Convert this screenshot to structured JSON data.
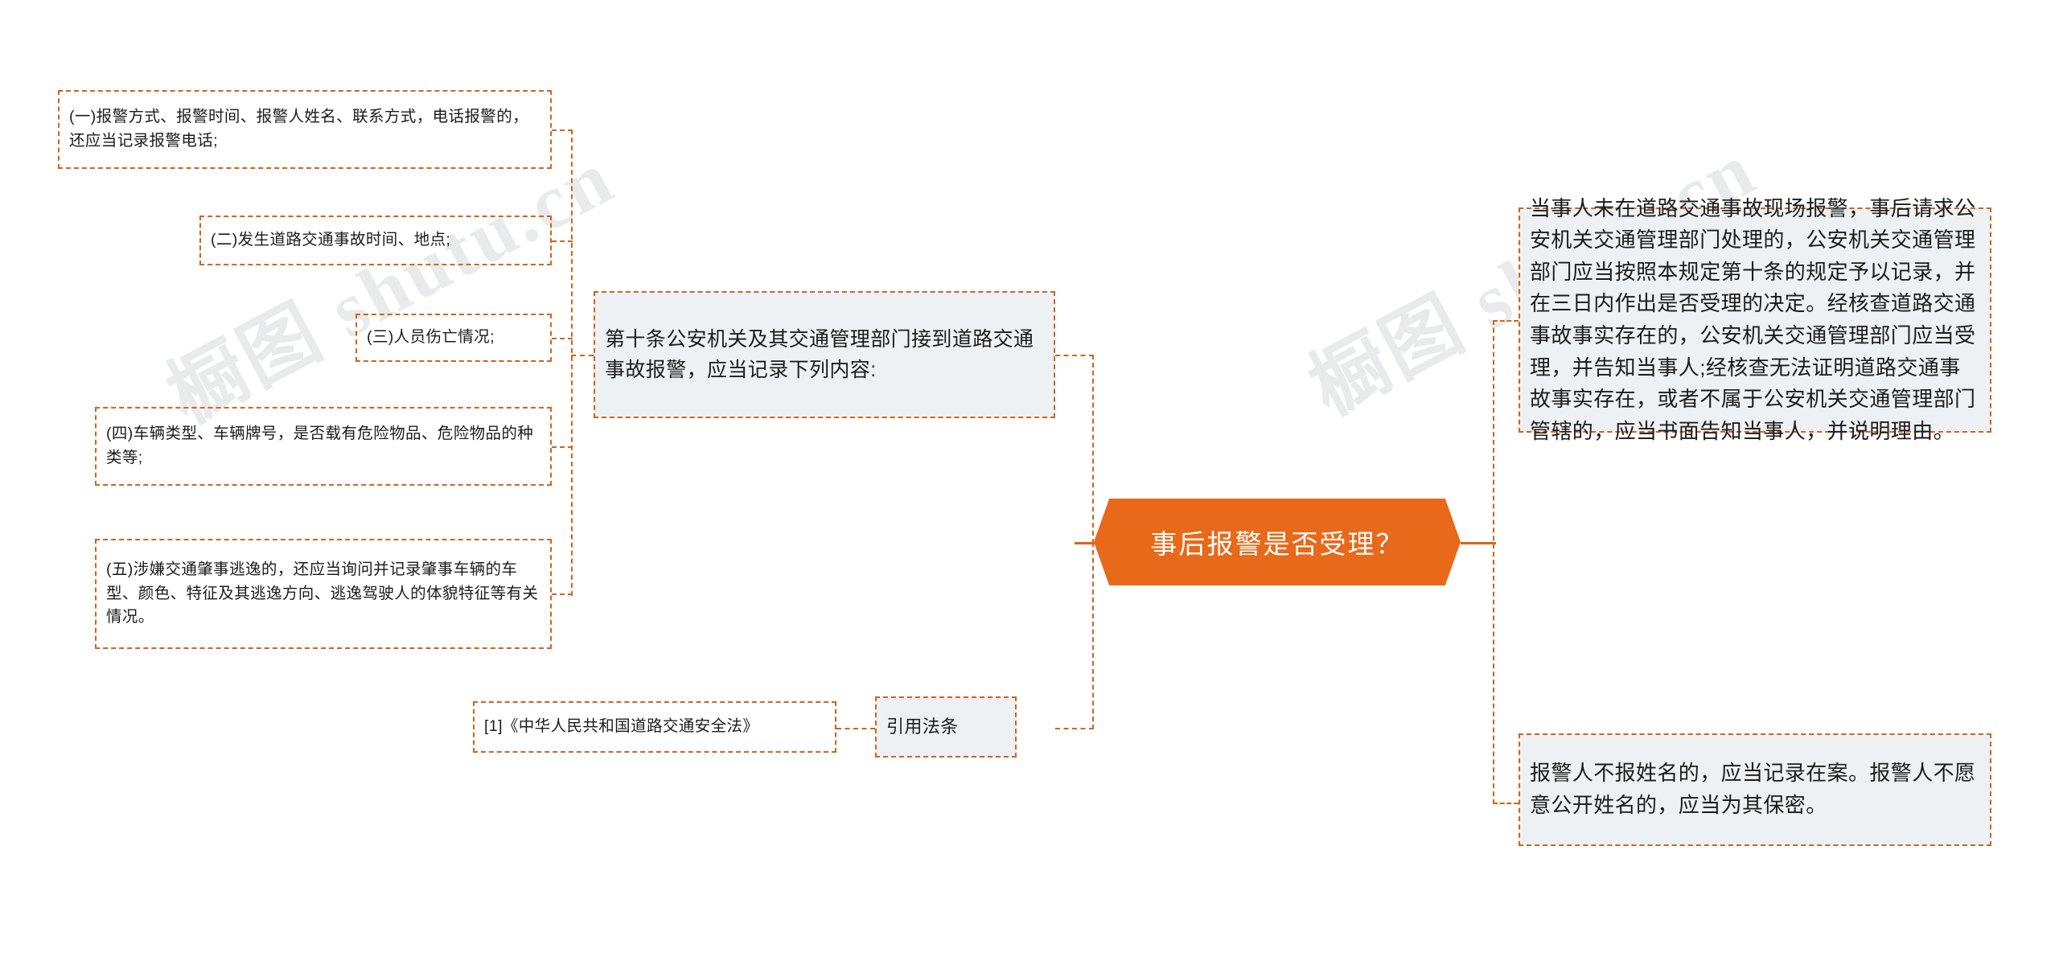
{
  "diagram": {
    "title": "事后报警是否受理？",
    "accent_color": "#E8691A",
    "dash_color": "#D1641E",
    "panel_color": "#EDF1F4",
    "watermark_text": "橱图 shutu.cn"
  },
  "center": {
    "label": "事后报警是否受理？"
  },
  "left_branch": {
    "parent": {
      "label": "第十条公安机关及其交通管理部门接到道路交通事故报警，应当记录下列内容:"
    },
    "children": [
      {
        "label": "(一)报警方式、报警时间、报警人姓名、联系方式，电话报警的，还应当记录报警电话;"
      },
      {
        "label": "(二)发生道路交通事故时间、地点;"
      },
      {
        "label": "(三)人员伤亡情况;"
      },
      {
        "label": "(四)车辆类型、车辆牌号，是否载有危险物品、危险物品的种类等;"
      },
      {
        "label": "(五)涉嫌交通肇事逃逸的，还应当询问并记录肇事车辆的车型、颜色、特征及其逃逸方向、逃逸驾驶人的体貌特征等有关情况。"
      }
    ]
  },
  "citation_branch": {
    "parent": {
      "label": "引用法条"
    },
    "children": [
      {
        "label": "[1]《中华人民共和国道路交通安全法》"
      }
    ]
  },
  "right_branch": {
    "items": [
      {
        "label": "当事人未在道路交通事故现场报警，事后请求公安机关交通管理部门处理的，公安机关交通管理部门应当按照本规定第十条的规定予以记录，并在三日内作出是否受理的决定。经核查道路交通事故事实存在的，公安机关交通管理部门应当受理，并告知当事人;经核查无法证明道路交通事故事实存在，或者不属于公安机关交通管理部门管辖的，应当书面告知当事人，并说明理由。"
      },
      {
        "label": "报警人不报姓名的，应当记录在案。报警人不愿意公开姓名的，应当为其保密。"
      }
    ]
  }
}
